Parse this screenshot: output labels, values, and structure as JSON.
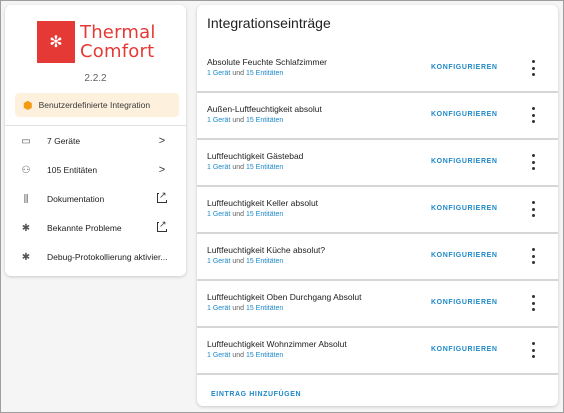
{
  "sidebar": {
    "logo_line1": "Thermal",
    "logo_line2": "Comfort",
    "version": "2.2.2",
    "badge_label": "Benutzerdefinierte Integration",
    "items": [
      {
        "label": "7 Geräte",
        "trail": ">"
      },
      {
        "label": "105 Entitäten",
        "trail": ">"
      },
      {
        "label": "Dokumentation",
        "trail": "external"
      },
      {
        "label": "Bekannte Probleme",
        "trail": "external"
      },
      {
        "label": "Debug-Protokollierung aktivier...",
        "trail": ""
      }
    ]
  },
  "main": {
    "title": "Integrationseinträge",
    "configure_label": "KONFIGURIEREN",
    "add_label": "EINTRAG HINZUFÜGEN",
    "entries": [
      {
        "name": "Absolute Feuchte Schlafzimmer",
        "devices": "1 Gerät",
        "and": "und",
        "entities": "15 Entitäten"
      },
      {
        "name": "Außen-Luftfeuchtigkeit absolut",
        "devices": "1 Gerät",
        "and": "und",
        "entities": "15 Entitäten"
      },
      {
        "name": "Luftfeuchtigkeit Gästebad",
        "devices": "1 Gerät",
        "and": "und",
        "entities": "15 Entitäten"
      },
      {
        "name": "Luftfeuchtigkeit Keller absolut",
        "devices": "1 Gerät",
        "and": "und",
        "entities": "15 Entitäten"
      },
      {
        "name": "Luftfeuchtigkeit Küche absolut?",
        "devices": "1 Gerät",
        "and": "und",
        "entities": "15 Entitäten"
      },
      {
        "name": "Luftfeuchtigkeit Oben Durchgang Absolut",
        "devices": "1 Gerät",
        "and": "und",
        "entities": "15 Entitäten"
      },
      {
        "name": "Luftfeuchtigkeit Wohnzimmer Absolut",
        "devices": "1 Gerät",
        "and": "und",
        "entities": "15 Entitäten"
      }
    ]
  },
  "colors": {
    "brand_red": "#e53935",
    "link_blue": "#1e88c8",
    "badge_bg": "#fdf0dd"
  },
  "icons": [
    "snowflake-icon",
    "package-icon",
    "devices-icon",
    "entities-icon",
    "documentation-icon",
    "bug-icon",
    "debug-bug-icon",
    "chevron-right-icon",
    "open-external-icon",
    "kebab-menu-icon"
  ]
}
